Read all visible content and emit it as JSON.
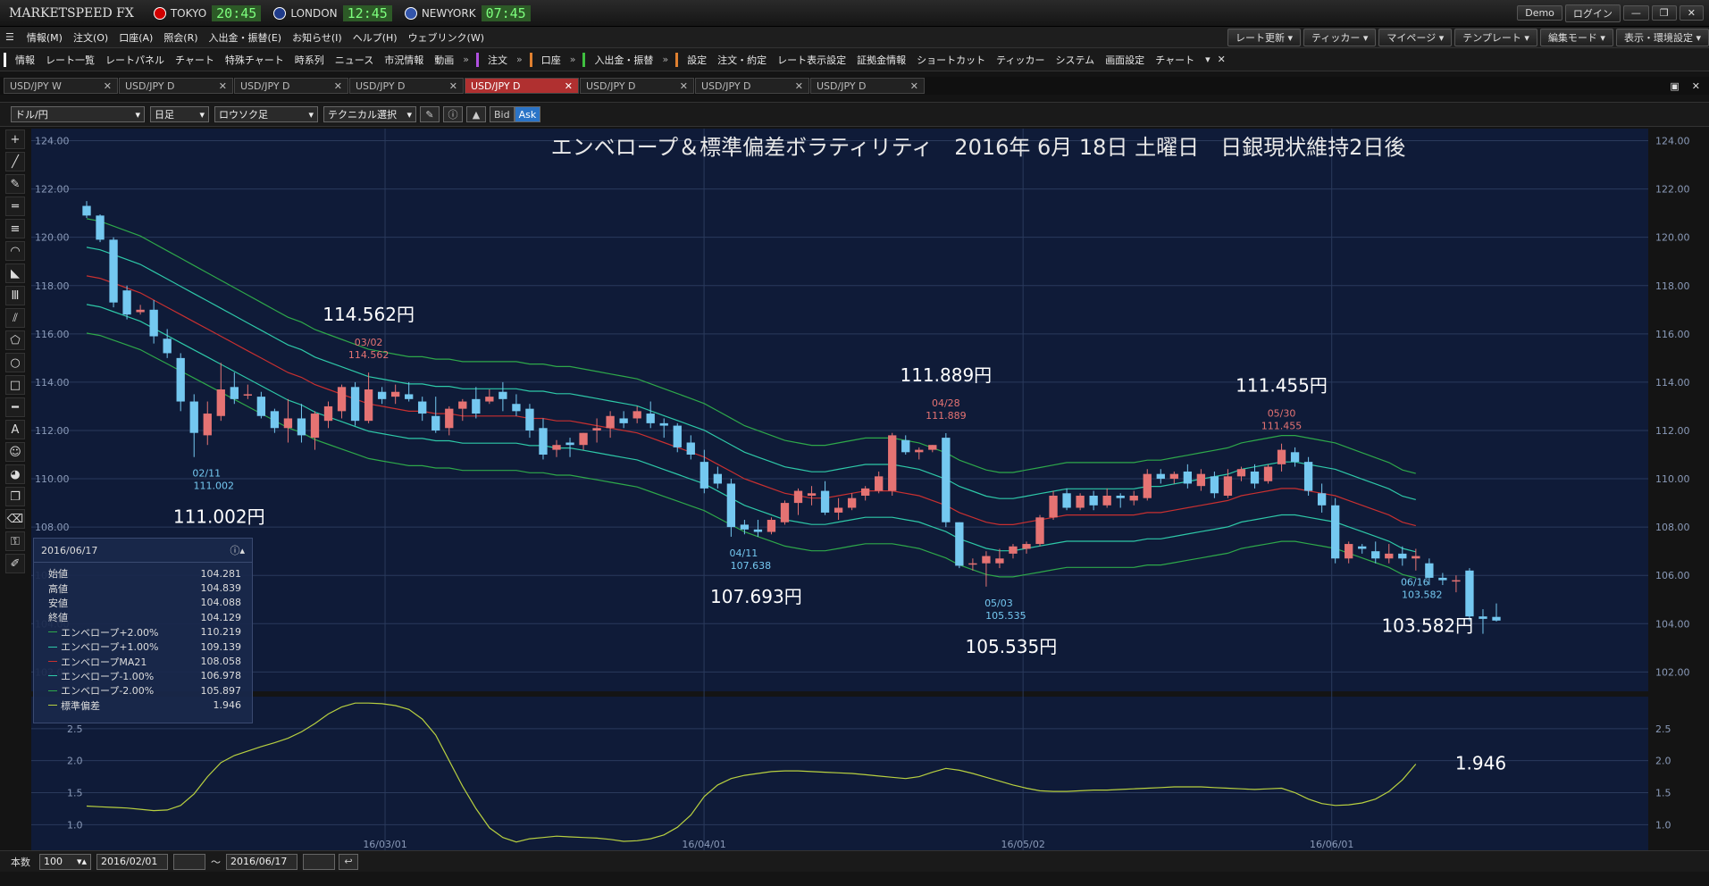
{
  "app": {
    "logo": "MARKETSPEED FX",
    "clocks": [
      {
        "city": "TOKYO",
        "time": "20:45",
        "color": "#d00000"
      },
      {
        "city": "LONDON",
        "time": "12:45",
        "color": "#1f3b8a"
      },
      {
        "city": "NEWYORK",
        "time": "07:45",
        "color": "#3355aa"
      }
    ],
    "demo_label": "Demo",
    "login_label": "ログイン"
  },
  "menu": {
    "items": [
      "情報(M)",
      "注文(O)",
      "口座(A)",
      "照会(R)",
      "入出金・振替(E)",
      "お知らせ(I)",
      "ヘルプ(H)",
      "ウェブリンク(W)"
    ],
    "right": [
      "レート更新",
      "ティッカー",
      "マイページ",
      "テンプレート",
      "編集モード",
      "表示・環境設定"
    ]
  },
  "toolbar": {
    "group1": [
      "情報",
      "レート一覧",
      "レートパネル",
      "チャート",
      "特殊チャート",
      "時系列",
      "ニュース",
      "市況情報",
      "動画"
    ],
    "group2": [
      "注文"
    ],
    "group3": [
      "口座"
    ],
    "group4": [
      "入出金・振替"
    ],
    "group5": [
      "設定",
      "注文・約定",
      "レート表示設定",
      "証拠金情報",
      "ショートカット",
      "ティッカー",
      "システム",
      "画面設定",
      "チャート"
    ]
  },
  "tabs": [
    "USD/JPY W",
    "USD/JPY D",
    "USD/JPY D",
    "USD/JPY D",
    "USD/JPY D",
    "USD/JPY D",
    "USD/JPY D",
    "USD/JPY D"
  ],
  "active_tab": 4,
  "chart_toolbar": {
    "pair": "ドル/円",
    "period": "日足",
    "style": "ロウソク足",
    "technical": "テクニカル選択",
    "bid": "Bid",
    "ask": "Ask"
  },
  "bottom": {
    "count_label": "本数",
    "count_value": "100",
    "from_date": "2016/02/01",
    "tilde": "～",
    "to_date": "2016/06/17"
  },
  "info_panel": {
    "date": "2016/06/17",
    "rows": [
      {
        "label": "始値",
        "value": "104.281",
        "color": ""
      },
      {
        "label": "高値",
        "value": "104.839",
        "color": ""
      },
      {
        "label": "安値",
        "value": "104.088",
        "color": ""
      },
      {
        "label": "終値",
        "value": "104.129",
        "color": ""
      },
      {
        "label": "エンベロープ+2.00%",
        "value": "110.219",
        "color": "#2ea84a"
      },
      {
        "label": "エンベロープ+1.00%",
        "value": "109.139",
        "color": "#2ec8a8"
      },
      {
        "label": "エンベロープMA21",
        "value": "108.058",
        "color": "#c83030"
      },
      {
        "label": "エンベロープ-1.00%",
        "value": "106.978",
        "color": "#2ec8a8"
      },
      {
        "label": "エンベロープ-2.00%",
        "value": "105.897",
        "color": "#2ea84a"
      },
      {
        "label": "標準偏差",
        "value": "1.946",
        "color": "#b8d040"
      }
    ]
  },
  "chart_data": {
    "type": "candlestick",
    "title": "エンベロープ＆標準偏差ボラティリティ　2016年 6月 18日 土曜日　日銀現状維持2日後",
    "y_range": [
      101.2,
      124.5
    ],
    "y_ticks": [
      "124.00",
      "122.00",
      "120.00",
      "118.00",
      "116.00",
      "114.00",
      "112.00",
      "110.00",
      "108.00",
      "106.00",
      "104.00",
      "102.00"
    ],
    "x_range": [
      "2016/02/01",
      "2016/06/17"
    ],
    "x_ticks": [
      {
        "label": "16/03/01",
        "date": "2016-03-01"
      },
      {
        "label": "16/04/01",
        "date": "2016-04-01"
      },
      {
        "label": "16/05/02",
        "date": "2016-05-02"
      },
      {
        "label": "16/06/01",
        "date": "2016-06-01"
      }
    ],
    "candles": [
      [
        121.3,
        121.5,
        120.9,
        120.8
      ],
      [
        120.9,
        120.95,
        119.9,
        119.8
      ],
      [
        119.9,
        120.0,
        117.3,
        117.1
      ],
      [
        117.8,
        118.0,
        116.8,
        116.6
      ],
      [
        116.9,
        117.2,
        117.0,
        116.8
      ],
      [
        117.0,
        117.4,
        115.9,
        115.6
      ],
      [
        115.8,
        116.2,
        115.2,
        115.0
      ],
      [
        115.0,
        115.2,
        113.2,
        112.8
      ],
      [
        113.2,
        113.5,
        111.9,
        110.9
      ],
      [
        111.8,
        113.2,
        112.7,
        111.4
      ],
      [
        112.6,
        114.8,
        113.7,
        112.4
      ],
      [
        113.8,
        114.4,
        113.3,
        113.1
      ],
      [
        113.5,
        113.9,
        113.5,
        113.3
      ],
      [
        113.4,
        113.6,
        112.6,
        112.5
      ],
      [
        112.8,
        112.9,
        112.1,
        111.9
      ],
      [
        112.1,
        113.3,
        112.5,
        111.5
      ],
      [
        112.5,
        113.1,
        111.8,
        111.5
      ],
      [
        111.7,
        112.8,
        112.7,
        111.2
      ],
      [
        112.4,
        113.2,
        113.0,
        112.1
      ],
      [
        112.8,
        113.9,
        113.8,
        112.5
      ],
      [
        113.8,
        114.0,
        112.4,
        112.2
      ],
      [
        112.4,
        114.4,
        113.7,
        112.3
      ],
      [
        113.6,
        113.8,
        113.3,
        113.1
      ],
      [
        113.4,
        113.9,
        113.6,
        113.1
      ],
      [
        113.5,
        114.0,
        113.3,
        113.2
      ],
      [
        113.2,
        113.4,
        112.7,
        112.4
      ],
      [
        112.6,
        113.4,
        112.0,
        111.9
      ],
      [
        112.1,
        113.0,
        112.9,
        111.8
      ],
      [
        112.9,
        113.3,
        113.2,
        112.4
      ],
      [
        113.3,
        113.8,
        112.7,
        112.5
      ],
      [
        113.2,
        113.7,
        113.4,
        113.1
      ],
      [
        113.6,
        114.0,
        113.3,
        112.8
      ],
      [
        113.1,
        113.5,
        112.8,
        112.6
      ],
      [
        112.9,
        113.1,
        112.0,
        111.7
      ],
      [
        112.1,
        112.5,
        111.0,
        110.8
      ],
      [
        111.2,
        111.6,
        111.4,
        110.9
      ],
      [
        111.5,
        111.7,
        111.4,
        110.9
      ],
      [
        111.4,
        111.9,
        111.9,
        111.2
      ],
      [
        112.0,
        112.5,
        112.1,
        111.5
      ],
      [
        112.1,
        112.8,
        112.6,
        111.7
      ],
      [
        112.5,
        112.8,
        112.3,
        112.1
      ],
      [
        112.5,
        113.0,
        112.8,
        112.3
      ],
      [
        112.7,
        113.2,
        112.3,
        112.1
      ],
      [
        112.3,
        112.5,
        112.2,
        111.7
      ],
      [
        112.2,
        112.3,
        111.3,
        111.1
      ],
      [
        111.5,
        111.8,
        111.0,
        110.8
      ],
      [
        110.7,
        111.2,
        109.6,
        109.4
      ],
      [
        110.2,
        110.5,
        109.8,
        109.6
      ],
      [
        109.8,
        110.0,
        108.0,
        107.6
      ],
      [
        108.1,
        108.3,
        107.9,
        107.7
      ],
      [
        107.9,
        108.3,
        107.8,
        107.6
      ],
      [
        107.8,
        108.4,
        108.3,
        107.7
      ],
      [
        108.2,
        109.1,
        109.0,
        108.1
      ],
      [
        109.0,
        109.6,
        109.5,
        108.5
      ],
      [
        109.3,
        109.7,
        109.4,
        108.9
      ],
      [
        109.5,
        109.9,
        108.6,
        108.5
      ],
      [
        108.6,
        109.2,
        108.8,
        108.3
      ],
      [
        108.8,
        109.4,
        109.2,
        108.7
      ],
      [
        109.3,
        109.7,
        109.6,
        109.1
      ],
      [
        109.5,
        110.3,
        110.1,
        109.4
      ],
      [
        109.5,
        111.9,
        111.8,
        109.3
      ],
      [
        111.6,
        111.8,
        111.1,
        111.0
      ],
      [
        111.1,
        111.3,
        111.2,
        110.8
      ],
      [
        111.2,
        111.4,
        111.4,
        111.1
      ],
      [
        111.7,
        111.889,
        108.2,
        108.0
      ],
      [
        108.2,
        108.2,
        106.4,
        106.3
      ],
      [
        106.5,
        106.7,
        106.5,
        106.2
      ],
      [
        106.5,
        107.0,
        106.8,
        105.535
      ],
      [
        106.5,
        107.1,
        106.7,
        106.3
      ],
      [
        106.9,
        107.3,
        107.2,
        106.7
      ],
      [
        107.1,
        107.4,
        107.3,
        106.9
      ],
      [
        107.3,
        108.5,
        108.4,
        107.2
      ],
      [
        108.4,
        109.5,
        109.3,
        108.3
      ],
      [
        109.4,
        109.6,
        108.8,
        108.7
      ],
      [
        108.8,
        109.4,
        109.3,
        108.7
      ],
      [
        109.3,
        109.5,
        108.9,
        108.7
      ],
      [
        108.9,
        109.6,
        109.3,
        108.8
      ],
      [
        109.3,
        109.4,
        109.2,
        108.8
      ],
      [
        109.1,
        109.5,
        109.3,
        108.9
      ],
      [
        109.2,
        110.4,
        110.2,
        109.1
      ],
      [
        110.2,
        110.4,
        110.0,
        109.8
      ],
      [
        110.0,
        110.3,
        110.2,
        109.8
      ],
      [
        110.3,
        110.6,
        109.8,
        109.6
      ],
      [
        109.7,
        110.4,
        110.2,
        109.5
      ],
      [
        110.1,
        110.3,
        109.4,
        109.2
      ],
      [
        109.3,
        110.4,
        110.1,
        109.2
      ],
      [
        110.1,
        110.5,
        110.4,
        109.9
      ],
      [
        110.3,
        110.6,
        109.8,
        109.6
      ],
      [
        109.9,
        110.6,
        110.5,
        109.8
      ],
      [
        110.6,
        111.455,
        111.2,
        110.3
      ],
      [
        111.1,
        111.3,
        110.7,
        110.5
      ],
      [
        110.7,
        110.9,
        109.5,
        109.3
      ],
      [
        109.4,
        109.8,
        108.9,
        108.6
      ],
      [
        108.9,
        109.2,
        106.7,
        106.5
      ],
      [
        106.7,
        107.4,
        107.3,
        106.5
      ],
      [
        107.2,
        107.3,
        107.1,
        106.9
      ],
      [
        107.0,
        107.4,
        106.7,
        106.5
      ],
      [
        106.7,
        107.3,
        106.9,
        106.5
      ],
      [
        106.9,
        107.2,
        106.7,
        106.4
      ],
      [
        106.7,
        107.1,
        106.8,
        106.2
      ],
      [
        106.5,
        106.7,
        105.9,
        105.6
      ],
      [
        105.9,
        106.1,
        105.8,
        105.6
      ],
      [
        105.8,
        106.0,
        105.8,
        105.3
      ],
      [
        106.2,
        106.3,
        104.3,
        104.1
      ],
      [
        104.3,
        104.6,
        104.2,
        103.582
      ],
      [
        104.281,
        104.839,
        104.129,
        104.088
      ]
    ],
    "ma21": [
      118.4,
      118.3,
      118.1,
      117.9,
      117.7,
      117.4,
      117.1,
      116.8,
      116.5,
      116.2,
      115.9,
      115.6,
      115.3,
      115.0,
      114.7,
      114.4,
      114.2,
      113.9,
      113.7,
      113.5,
      113.3,
      113.1,
      113.0,
      112.9,
      112.8,
      112.8,
      112.7,
      112.7,
      112.6,
      112.6,
      112.6,
      112.6,
      112.6,
      112.5,
      112.5,
      112.4,
      112.4,
      112.3,
      112.2,
      112.1,
      112.0,
      111.9,
      111.7,
      111.5,
      111.3,
      111.1,
      110.9,
      110.6,
      110.3,
      110.0,
      109.8,
      109.6,
      109.4,
      109.3,
      109.2,
      109.2,
      109.3,
      109.4,
      109.5,
      109.5,
      109.5,
      109.4,
      109.3,
      109.1,
      108.9,
      108.6,
      108.4,
      108.2,
      108.1,
      108.1,
      108.2,
      108.3,
      108.4,
      108.5,
      108.5,
      108.5,
      108.5,
      108.5,
      108.5,
      108.6,
      108.6,
      108.7,
      108.8,
      108.9,
      109.0,
      109.1,
      109.3,
      109.4,
      109.5,
      109.6,
      109.6,
      109.5,
      109.4,
      109.3,
      109.1,
      108.9,
      108.7,
      108.5,
      108.2,
      108.058
    ],
    "env_pct": [
      2,
      1,
      -1,
      -2
    ],
    "stddev_series": [
      1.29,
      1.28,
      1.27,
      1.26,
      1.24,
      1.22,
      1.23,
      1.3,
      1.48,
      1.75,
      1.97,
      2.08,
      2.15,
      2.22,
      2.28,
      2.35,
      2.45,
      2.58,
      2.73,
      2.84,
      2.9,
      2.9,
      2.89,
      2.86,
      2.8,
      2.65,
      2.4,
      2.0,
      1.6,
      1.25,
      0.95,
      0.8,
      0.73,
      0.78,
      0.8,
      0.82,
      0.81,
      0.8,
      0.79,
      0.77,
      0.74,
      0.75,
      0.78,
      0.84,
      0.96,
      1.15,
      1.44,
      1.62,
      1.72,
      1.77,
      1.8,
      1.83,
      1.84,
      1.84,
      1.83,
      1.82,
      1.81,
      1.8,
      1.78,
      1.76,
      1.74,
      1.72,
      1.75,
      1.82,
      1.88,
      1.85,
      1.8,
      1.74,
      1.68,
      1.62,
      1.57,
      1.53,
      1.52,
      1.52,
      1.53,
      1.54,
      1.54,
      1.55,
      1.56,
      1.57,
      1.58,
      1.59,
      1.59,
      1.59,
      1.58,
      1.57,
      1.56,
      1.55,
      1.56,
      1.57,
      1.5,
      1.4,
      1.33,
      1.3,
      1.31,
      1.34,
      1.4,
      1.52,
      1.7,
      1.946
    ],
    "stddev_range": [
      0.6,
      3.0
    ],
    "stddev_ticks": [
      "2.5",
      "2.0",
      "1.5",
      "1.0"
    ],
    "annotations": [
      {
        "idx": 8,
        "text": "111.002円",
        "small_date": "02/11",
        "small_val": "111.002",
        "type": "low"
      },
      {
        "idx": 21,
        "text": "114.562円",
        "small_date": "03/02",
        "small_val": "114.562",
        "type": "high"
      },
      {
        "idx": 48,
        "text": "107.693円",
        "small_date": "04/11",
        "small_val": "107.638",
        "type": "low"
      },
      {
        "idx": 64,
        "text": "111.889円",
        "small_date": "04/28",
        "small_val": "111.889",
        "type": "high"
      },
      {
        "idx": 67,
        "text": "105.535円",
        "small_date": "05/03",
        "small_val": "105.535",
        "type": "low"
      },
      {
        "idx": 89,
        "text": "111.455円",
        "small_date": "05/30",
        "small_val": "111.455",
        "type": "high"
      },
      {
        "idx": 98,
        "text": "103.582円",
        "small_date": "06/16",
        "small_val": "103.582",
        "type": "low"
      }
    ],
    "stddev_last_label": "1.946",
    "colors": {
      "up": "#e57373",
      "down": "#74c8f0",
      "ma": "#c83030",
      "env1": "#2ec8a8",
      "env2": "#2ea84a",
      "stddev": "#b8d040",
      "bg": "#0f1b38"
    }
  }
}
